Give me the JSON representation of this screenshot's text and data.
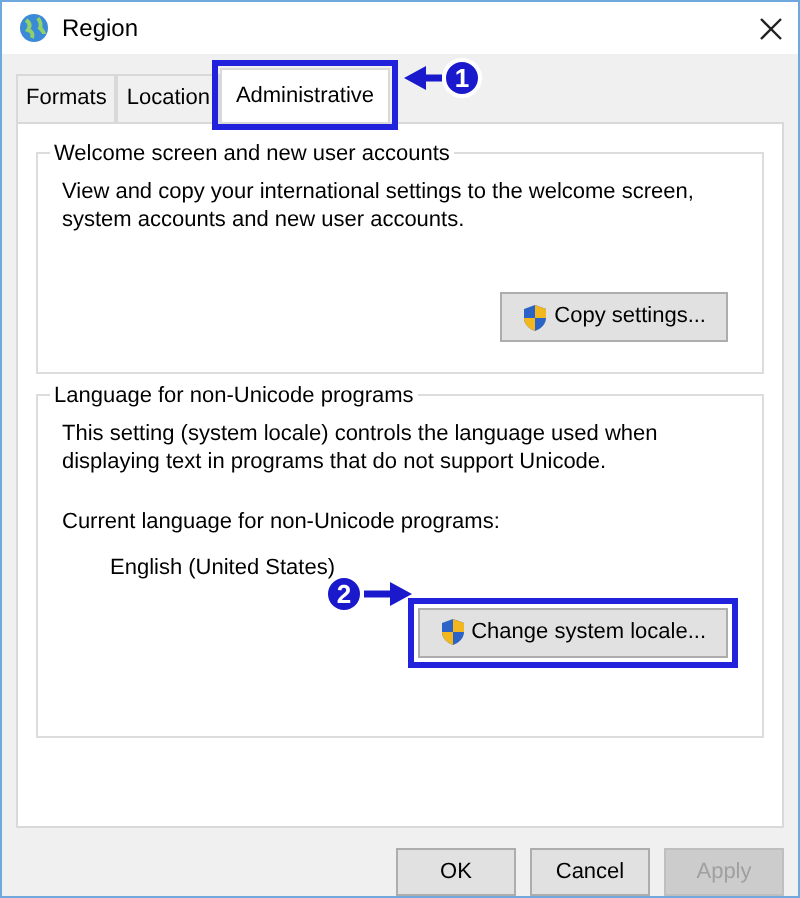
{
  "window": {
    "title": "Region"
  },
  "tabs": [
    {
      "label": "Formats",
      "selected": false,
      "highlighted": false
    },
    {
      "label": "Location",
      "selected": false,
      "highlighted": false
    },
    {
      "label": "Administrative",
      "selected": true,
      "highlighted": true
    }
  ],
  "groups": [
    {
      "title": "Welcome screen and new user accounts",
      "description": "View and copy your international settings to the welcome screen, system accounts and new user accounts.",
      "button": {
        "label": "Copy settings...",
        "highlighted": false
      }
    },
    {
      "title": "Language for non-Unicode programs",
      "description": "This setting (system locale) controls the language used when displaying text in programs that do not support Unicode.",
      "current_label": "Current language for non-Unicode programs:",
      "current_value": "English (United States)",
      "button": {
        "label": "Change system locale...",
        "highlighted": true
      }
    }
  ],
  "buttons": [
    {
      "label": "OK",
      "disabled": false
    },
    {
      "label": "Cancel",
      "disabled": false
    },
    {
      "label": "Apply",
      "disabled": true
    }
  ],
  "step_markers": [
    "1",
    "2"
  ]
}
